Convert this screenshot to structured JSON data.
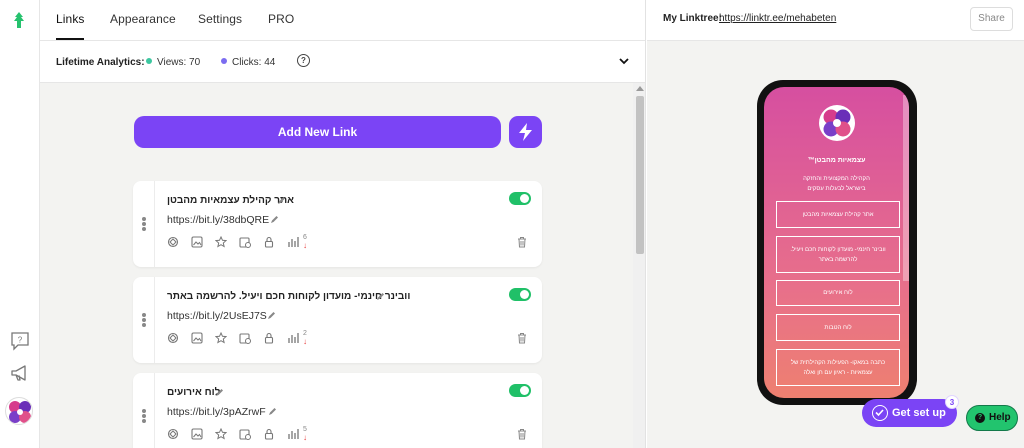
{
  "nav": {
    "tabs": [
      "Links",
      "Appearance",
      "Settings",
      "PRO"
    ],
    "active_tab": "Links"
  },
  "analytics": {
    "label": "Lifetime Analytics:",
    "views": "Views: 70",
    "clicks": "Clicks: 44",
    "views_color": "#3cc7a0",
    "clicks_color": "#7b6cf0",
    "help_icon": "question-circle-icon"
  },
  "add_link": {
    "label": "Add New Link",
    "color": "#7b44f5",
    "bolt_icon": "bolt-icon"
  },
  "links": [
    {
      "title": "אתר קהילת עצמאיות מהבטן",
      "url": "https://bit.ly/38dbQRE",
      "count": "6",
      "enabled": true
    },
    {
      "title": "וובינר חינמי- מועדון לקוחות חכם ויעיל. להרשמה באתר",
      "url": "https://bit.ly/2UsEJ7S",
      "count": "2",
      "enabled": true
    },
    {
      "title": "לוח אירועים",
      "url": "https://bit.ly/3pAZrwF",
      "count": "5",
      "enabled": true
    }
  ],
  "preview": {
    "label": "My Linktree:",
    "url": "https://linktr.ee/mehabeten",
    "share_label": "Share",
    "profile_name": "עצמאיות מהבטן™",
    "bio_line1": "הקהילה המקצועית והחזקה",
    "bio_line2": "בישראל לבעלות עסקים",
    "buttons": [
      "אתר קהילת עצמאיות מהבטן",
      "וובינר חינמי- מועדון לקוחות חכם ויעיל. להרשמה באתר",
      "לוח אירועים",
      "לוח הטבות",
      "כתבה במאקו- הפעילות הקהילתית של עצמאיות - ראיון עם חן ואלה"
    ]
  },
  "widgets": {
    "get_set_up": "Get set up",
    "badge": "3",
    "help": "Help",
    "accent": "#7b44f5",
    "toggle_on": "#20c068"
  }
}
